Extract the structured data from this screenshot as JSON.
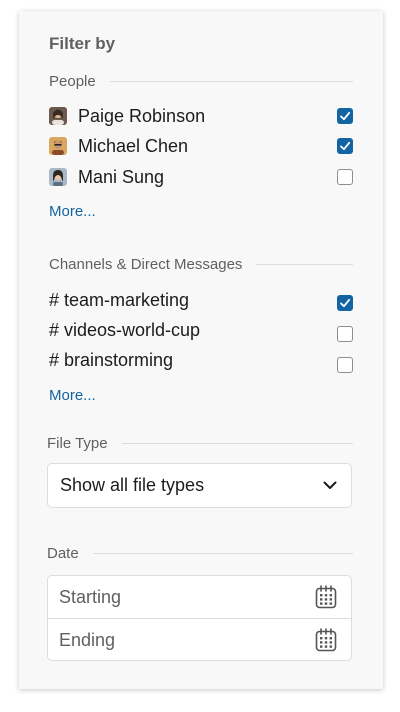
{
  "filter": {
    "title": "Filter by",
    "people": {
      "heading": "People",
      "items": [
        {
          "name": "Paige Robinson",
          "checked": true
        },
        {
          "name": "Michael Chen",
          "checked": true
        },
        {
          "name": "Mani Sung",
          "checked": false
        }
      ],
      "more_label": "More..."
    },
    "channels": {
      "heading": "Channels & Direct Messages",
      "items": [
        {
          "name": "# team-marketing",
          "checked": true
        },
        {
          "name": "# videos-world-cup",
          "checked": false
        },
        {
          "name": "# brainstorming",
          "checked": false
        }
      ],
      "more_label": "More..."
    },
    "file_type": {
      "heading": "File Type",
      "selected": "Show all file types"
    },
    "date": {
      "heading": "Date",
      "starting_placeholder": "Starting",
      "ending_placeholder": "Ending"
    }
  },
  "colors": {
    "accent": "#1264a3",
    "link": "#1264a3",
    "panel_bg": "#f8f8f8"
  }
}
